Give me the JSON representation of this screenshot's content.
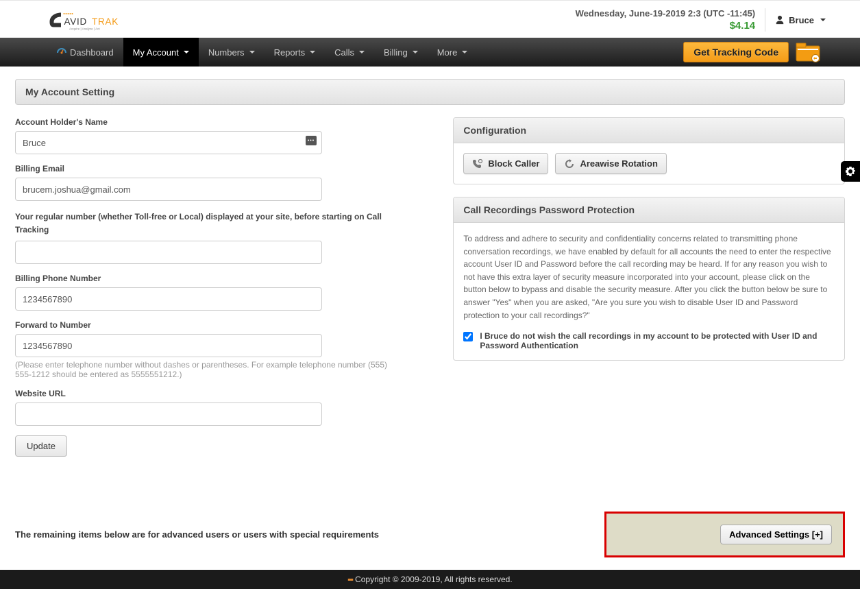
{
  "header": {
    "logo_main": "AVIDTRAK",
    "logo_sub": "Acquire | Analyze | Act",
    "datetime": "Wednesday, June-19-2019 2:3 (UTC -11:45)",
    "balance": "$4.14",
    "user": "Bruce"
  },
  "nav": {
    "items": [
      {
        "label": "Dashboard",
        "has_caret": false,
        "icon": "dashboard"
      },
      {
        "label": "My Account",
        "has_caret": true,
        "active": true
      },
      {
        "label": "Numbers",
        "has_caret": true
      },
      {
        "label": "Reports",
        "has_caret": true
      },
      {
        "label": "Calls",
        "has_caret": true
      },
      {
        "label": "Billing",
        "has_caret": true
      },
      {
        "label": "More",
        "has_caret": true
      }
    ],
    "tracking_btn": "Get Tracking Code"
  },
  "page": {
    "title": "My Account Setting"
  },
  "form": {
    "name_label": "Account Holder's Name",
    "name_value": "Bruce",
    "email_label": "Billing Email",
    "email_value": "brucem.joshua@gmail.com",
    "regular_label": "Your regular number (whether Toll-free or Local) displayed at your site, before starting on Call Tracking",
    "regular_value": "",
    "billing_phone_label": "Billing Phone Number",
    "billing_phone_value": "1234567890",
    "forward_label": "Forward to Number",
    "forward_value": "1234567890",
    "forward_hint": "(Please enter telephone number without dashes or parentheses. For example telephone number (555) 555-1212 should be entered as 5555551212.)",
    "website_label": "Website URL",
    "website_value": "",
    "update_btn": "Update"
  },
  "config": {
    "title": "Configuration",
    "block_caller": "Block Caller",
    "areawise": "Areawise Rotation"
  },
  "recordings": {
    "title": "Call Recordings Password Protection",
    "desc": "To address and adhere to security and confidentiality concerns related to transmitting phone conversation recordings, we have enabled by default for all accounts the need to enter the respective account User ID and Password before the call recording may be heard. If for any reason you wish to not have this extra layer of security measure incorporated into your account, please click on the button below to bypass and disable the security measure. After you click the button below be sure to answer \"Yes\" when you are asked, \"Are you sure you wish to disable User ID and Password protection to your call recordings?\"",
    "checkbox_label": "I Bruce do not wish the call recordings in my account to be protected with User ID and Password Authentication",
    "checked": true
  },
  "advanced": {
    "note": "The remaining items below are for advanced users or users with special requirements",
    "btn": "Advanced Settings [+]"
  },
  "footer": {
    "text": "Copyright © 2009-2019, All rights reserved."
  }
}
